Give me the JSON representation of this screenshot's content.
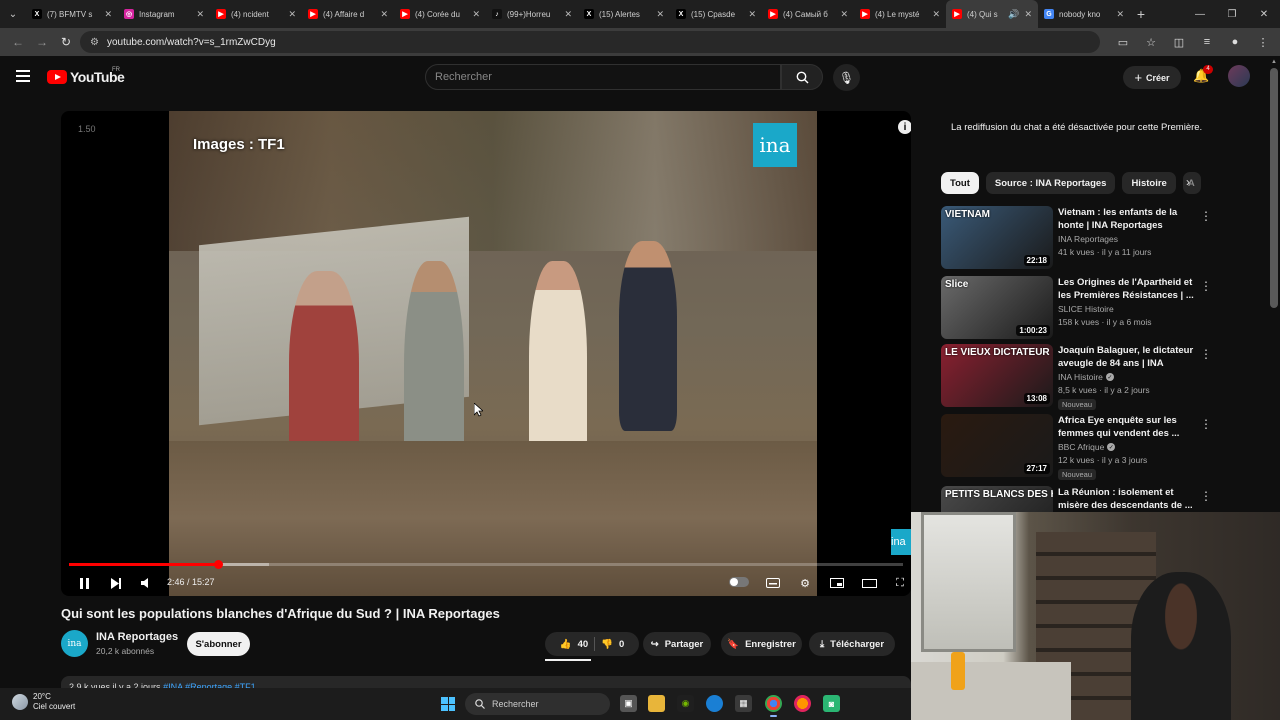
{
  "browser": {
    "tabs": [
      {
        "title": "(7) BFMTV s",
        "favicon": "x-icon",
        "color": "#000000"
      },
      {
        "title": "Instagram",
        "favicon": "instagram-icon",
        "color": "#d6249f"
      },
      {
        "title": "(4) ncident",
        "favicon": "youtube-icon",
        "color": "#ff0000"
      },
      {
        "title": "(4) Affaire d",
        "favicon": "youtube-icon",
        "color": "#ff0000"
      },
      {
        "title": "(4) Corée du",
        "favicon": "youtube-icon",
        "color": "#ff0000"
      },
      {
        "title": "(99+)Horreu",
        "favicon": "tiktok-icon",
        "color": "#111111"
      },
      {
        "title": "(15) Alertes",
        "favicon": "x-icon",
        "color": "#000000"
      },
      {
        "title": "(15) Cpasde",
        "favicon": "x-icon",
        "color": "#000000"
      },
      {
        "title": "(4) Самый б",
        "favicon": "youtube-icon",
        "color": "#ff0000"
      },
      {
        "title": "(4) Le mysté",
        "favicon": "youtube-icon",
        "color": "#ff0000"
      },
      {
        "title": "(4) Qui s",
        "favicon": "youtube-icon",
        "color": "#ff0000",
        "active": true
      },
      {
        "title": "nobody kno",
        "favicon": "google-icon",
        "color": "#4285f4"
      }
    ],
    "url": "youtube.com/watch?v=s_1rmZwCDyg"
  },
  "youtube": {
    "logo_text": "YouTube",
    "region": "FR",
    "search_placeholder": "Rechercher",
    "create_label": "Créer",
    "notif_count": "4"
  },
  "player": {
    "speed_label": "1.50",
    "watermark_text": "Images : TF1",
    "brand_logo": "ina",
    "time": "2:46 / 15:27",
    "progress": 0.179,
    "buffered": 0.24
  },
  "video": {
    "title": "Qui sont les populations blanches d'Afrique du Sud ? | INA Reportages",
    "channel": "INA Reportages",
    "subscribers": "20,2 k abonnés",
    "subscribe_label": "S'abonner",
    "likes": "40",
    "dislikes": "0",
    "share_label": "Partager",
    "save_label": "Enregistrer",
    "download_label": "Télécharger",
    "desc_meta": "2,9 k vues  il y a 2 jours",
    "desc_tags": "#INA #Reportage #TF1"
  },
  "sidebar": {
    "chat_notice": "La rediffusion du chat a été désactivée pour cette Première.",
    "chips": [
      "Tout",
      "Source : INA Reportages",
      "Histoire",
      "A"
    ],
    "recommendations": [
      {
        "title": "Vietnam : les enfants de la honte | INA Reportages",
        "channel": "INA Reportages",
        "verified": false,
        "meta": "41 k vues · il y a 11 jours",
        "duration": "22:18",
        "overlay": "VIETNAM",
        "bg": "#3a5a78",
        "badge": ""
      },
      {
        "title": "Les Origines de l'Apartheid et les Premières Résistances | ...",
        "channel": "SLICE Histoire",
        "verified": false,
        "meta": "158 k vues · il y a 6 mois",
        "duration": "1:00:23",
        "overlay": "Slice",
        "bg": "#6a6a6a",
        "badge": ""
      },
      {
        "title": "Joaquín Balaguer, le dictateur aveugle de 84 ans | INA Histoir...",
        "channel": "INA Histoire",
        "verified": true,
        "meta": "8,5 k vues · il y a 2 jours",
        "duration": "13:08",
        "overlay": "LE VIEUX DICTATEUR",
        "bg": "#8a2030",
        "badge": "Nouveau"
      },
      {
        "title": "Africa Eye enquête sur les femmes qui vendent des ...",
        "channel": "BBC Afrique",
        "verified": true,
        "meta": "12 k vues · il y a 3 jours",
        "duration": "27:17",
        "overlay": "",
        "bg": "#2a1a10",
        "badge": "Nouveau"
      },
      {
        "title": "La Réunion : isolement et misère des descendants de ...",
        "channel": "",
        "verified": false,
        "meta": "",
        "duration": "",
        "overlay": "PETITS BLANCS DES HAUTS",
        "bg": "#4a4a4a",
        "badge": ""
      }
    ]
  },
  "taskbar": {
    "temp": "20°C",
    "weather": "Ciel couvert",
    "search_label": "Rechercher"
  }
}
